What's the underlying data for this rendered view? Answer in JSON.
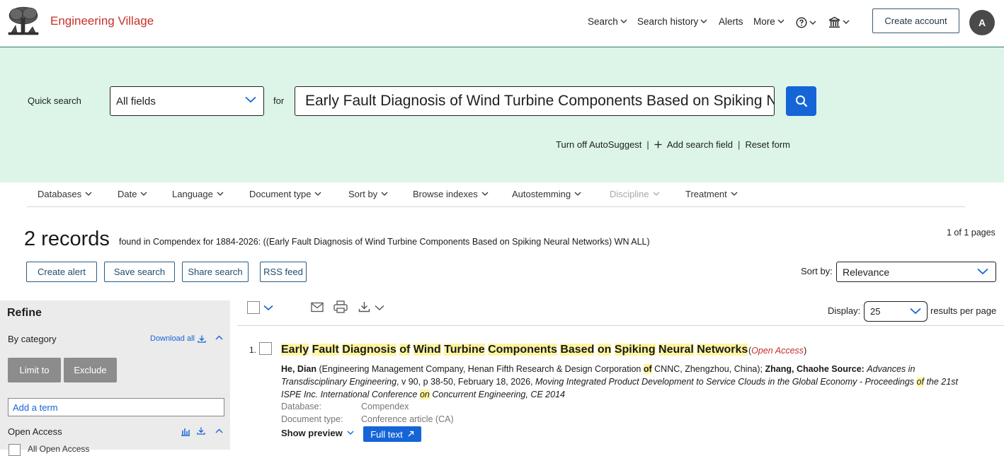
{
  "header": {
    "brand": "Engineering Village",
    "nav": [
      {
        "label": "Search",
        "icon": "chevron-down-icon"
      },
      {
        "label": "Search history",
        "icon": "chevron-down-icon"
      },
      {
        "label": "Alerts"
      },
      {
        "label": "More",
        "icon": "chevron-down-icon"
      }
    ],
    "create_account": "Create account",
    "avatar_initial": "A"
  },
  "search": {
    "quick_search_label": "Quick search",
    "field_value": "All fields",
    "for_label": "for",
    "query_value": "Early Fault Diagnosis of Wind Turbine Components Based on Spiking Neural Networks",
    "links": [
      "Turn off AutoSuggest",
      "Add search field",
      "Reset form"
    ]
  },
  "filters": [
    {
      "label": "Databases",
      "disabled": false
    },
    {
      "label": "Date",
      "disabled": false
    },
    {
      "label": "Language",
      "disabled": false
    },
    {
      "label": "Document type",
      "disabled": false
    },
    {
      "label": "Sort by",
      "disabled": false
    },
    {
      "label": "Browse indexes",
      "disabled": false
    },
    {
      "label": "Autostemming",
      "disabled": false
    },
    {
      "label": "Discipline",
      "disabled": true
    },
    {
      "label": "Treatment",
      "disabled": false
    }
  ],
  "results": {
    "count": "2 records",
    "description": "found in Compendex for 1884-2026: ((Early Fault Diagnosis of Wind Turbine Components Based on Spiking Neural Networks) WN ALL)",
    "page_info": "1 of 1 pages",
    "actions": [
      "Create alert",
      "Save search",
      "Share search",
      "RSS feed"
    ],
    "sort_label": "Sort by:",
    "sort_value": "Relevance",
    "display_label": "Display:",
    "display_value": "25",
    "rpp_label": "results per page"
  },
  "refine": {
    "title": "Refine",
    "by_category": "By category",
    "download_all": "Download all",
    "limit_to": "Limit to",
    "exclude": "Exclude",
    "add_term_placeholder": "Add a term",
    "open_access": "Open Access",
    "all_open_access": "All Open Access"
  },
  "items": [
    {
      "number": "1.",
      "title_words": [
        "Early",
        "Fault",
        "Diagnosis",
        "of",
        "Wind",
        "Turbine",
        "Components",
        "Based",
        "on",
        "Spiking",
        "Neural",
        "Networks"
      ],
      "open_access": "Open Access",
      "author1": "He, Dian",
      "affil1": "(Engineering Management Company, Henan Fifth Research & Design Corporation",
      "affil1_hl": "of",
      "affil2": "CNNC, Zhengzhou, China);",
      "author2": "Zhang, Chaohe",
      "source_label": "Source:",
      "source_journal": "Advances in Transdisciplinary Engineering",
      "source_detail": ", v 90, p 38-50, February 18, 2026,",
      "source_conf_a": "Moving Integrated Product Development to Service Clouds in the Global Economy - Proceedings",
      "source_conf_hl1": "of",
      "source_conf_b": "the 21st ISPE Inc. International Conference",
      "source_conf_hl2": "on",
      "source_conf_c": "Concurrent Engineering, CE 2014",
      "database_label": "Database:",
      "database_value": "Compendex",
      "doctype_label": "Document type:",
      "doctype_value": "Conference article (CA)",
      "show_preview": "Show preview",
      "full_text": "Full text"
    }
  ],
  "colors": {
    "brand": "#c8302a",
    "band": "#dcf5e8",
    "primary": "#1565d8",
    "highlight": "#fff5a0"
  }
}
